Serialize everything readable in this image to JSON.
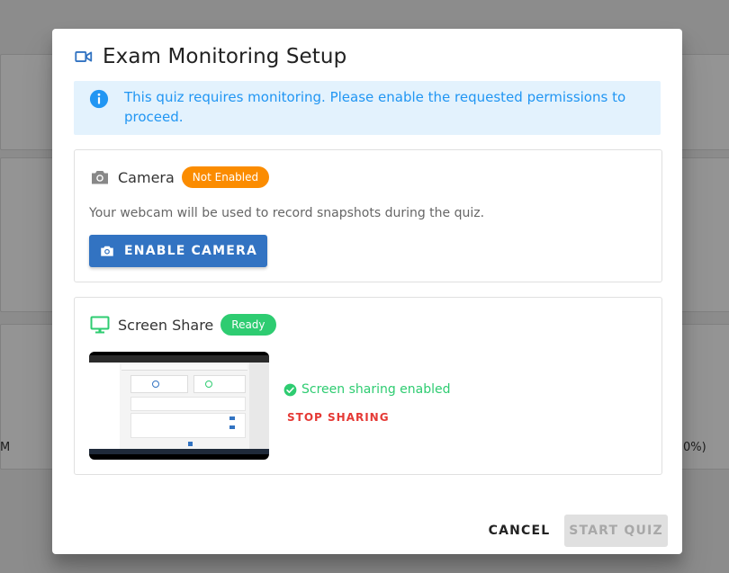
{
  "dialog": {
    "title": "Exam Monitoring Setup",
    "title_icon": "video-camera-icon",
    "info_icon": "info-icon",
    "info_text": "This quiz requires monitoring. Please enable the requested permissions to proceed."
  },
  "camera": {
    "title": "Camera",
    "icon": "camera-icon",
    "status": "Not Enabled",
    "description": "Your webcam will be used to record snapshots during the quiz.",
    "enable_button": "ENABLE CAMERA"
  },
  "screen": {
    "title": "Screen Share",
    "icon": "monitor-icon",
    "status": "Ready",
    "status_text": "Screen sharing enabled",
    "stop_button": "STOP SHARING"
  },
  "footer": {
    "cancel": "CANCEL",
    "start": "START QUIZ"
  },
  "background": {
    "left_text": "M",
    "right_text": "0%)"
  },
  "colors": {
    "accent": "#3273c2",
    "info_blue": "#2196f3",
    "info_bg": "#e3f2fd",
    "warning": "#fb8c00",
    "success": "#2ecc71",
    "danger": "#e53935"
  }
}
